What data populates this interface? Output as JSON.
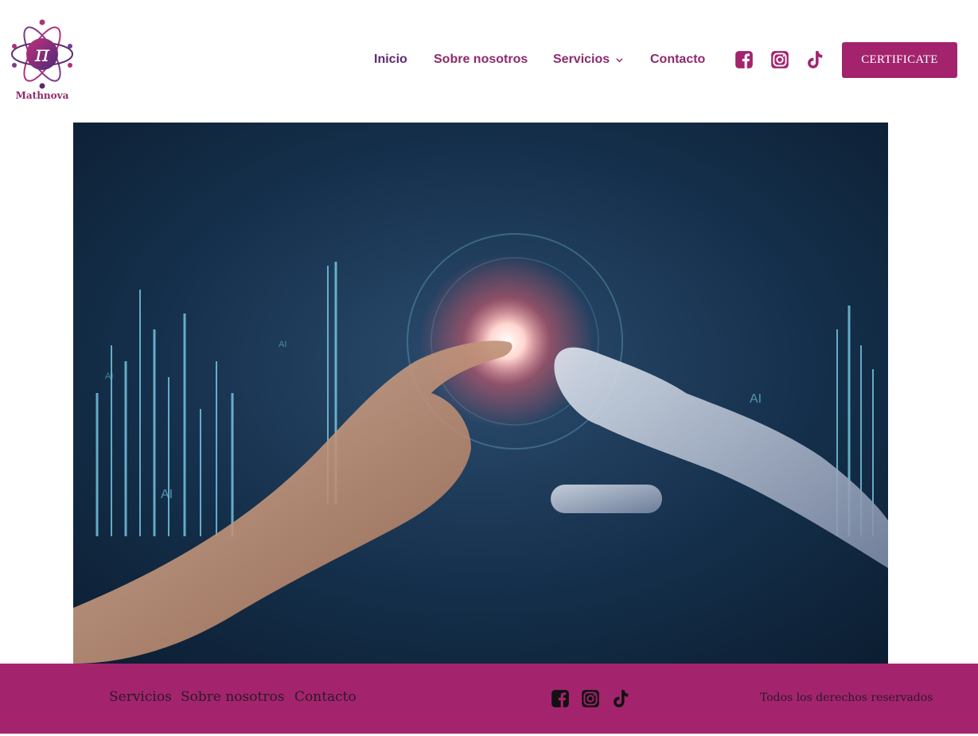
{
  "logo": {
    "text": "Mathnova",
    "icon": "pi-atom-logo"
  },
  "nav": {
    "items": [
      "Inicio",
      "Sobre nosotros",
      "Servicios",
      "Contacto"
    ],
    "dropdown_icon": "chevron-down-icon"
  },
  "social": [
    "facebook-icon",
    "instagram-icon",
    "tiktok-icon"
  ],
  "cta": {
    "label": "CERTIFICATE"
  },
  "hero": {
    "alt": "human hand touching robotic hand with AI data background",
    "ai_labels": [
      "AI",
      "AI",
      "AI",
      "AI"
    ]
  },
  "footer": {
    "links": [
      "Servicios",
      "Sobre nosotros",
      "Contacto"
    ],
    "copyright": "Todos los derechos reservados"
  },
  "colors": {
    "brand": "#a3246d",
    "nav_text": "#8e2a6b",
    "footer_bg": "#a3246d"
  }
}
